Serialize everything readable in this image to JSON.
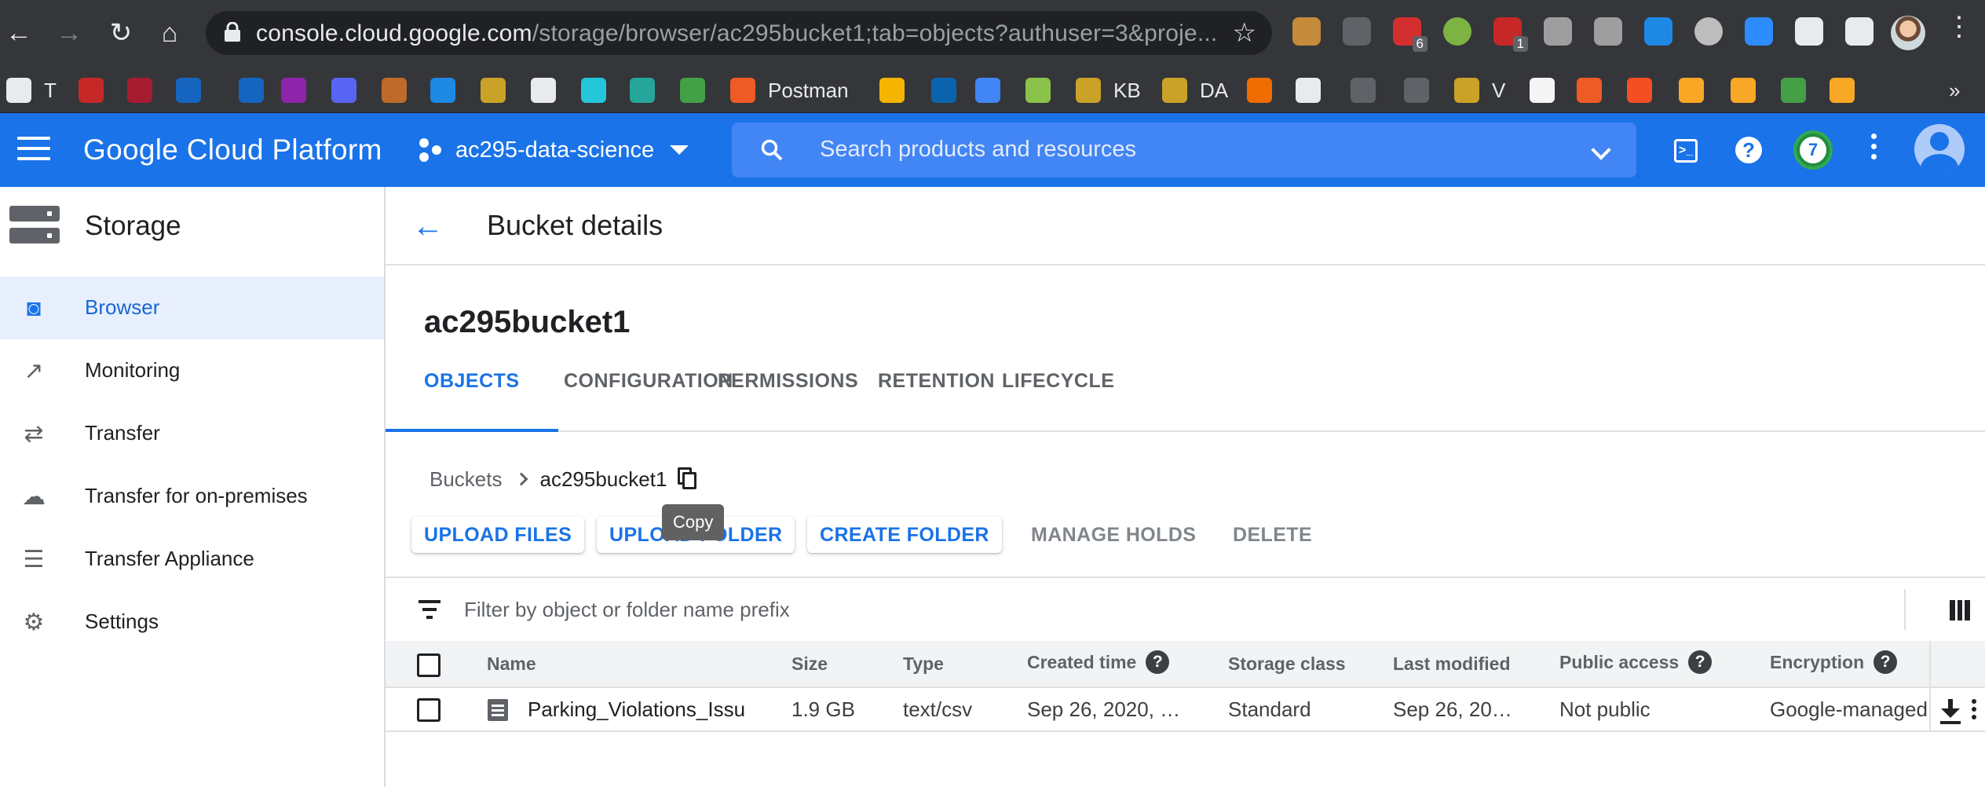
{
  "browser": {
    "url_host": "console.cloud.google.com",
    "url_path": "/storage/browser/ac295bucket1;tab=objects?authuser=3&proje...",
    "extensions": [
      {
        "name": "cookie-extension-icon",
        "color": "#c58a3a"
      },
      {
        "name": "pocket-icon",
        "color": "#5f6368"
      },
      {
        "name": "lastpass-icon",
        "color": "#d32f2f",
        "badge": "6"
      },
      {
        "name": "green-circle-extension-icon",
        "color": "#7cb342"
      },
      {
        "name": "red-hand-extension-icon",
        "color": "#c62828",
        "badge": "1"
      },
      {
        "name": "r-extension-icon",
        "color": "#9e9e9e"
      },
      {
        "name": "copy-extension-icon",
        "color": "#9e9e9e"
      },
      {
        "name": "blue-bolt-extension-icon",
        "color": "#1e88e5"
      },
      {
        "name": "record-extension-icon",
        "color": "#bdbdbd"
      },
      {
        "name": "zoom-icon",
        "color": "#2d8cff"
      },
      {
        "name": "puzzle-extensions-icon",
        "color": "#e8eaed"
      },
      {
        "name": "media-control-icon",
        "color": "#e8eaed"
      }
    ]
  },
  "bookmarks": [
    {
      "name": "globe-bookmark",
      "label": "T",
      "color": "#e8eaed"
    },
    {
      "name": "harvard-shield-bookmark",
      "label": "",
      "color": "#c62828"
    },
    {
      "name": "harvard-crimson-bookmark",
      "label": "",
      "color": "#a51c30"
    },
    {
      "name": "yale-bookmark",
      "label": "",
      "color": "#1565c0"
    },
    {
      "name": "yale-bookmark-2",
      "label": "",
      "color": "#1565c0"
    },
    {
      "name": "purple-heart-bookmark",
      "label": "",
      "color": "#8e24aa"
    },
    {
      "name": "discord-bookmark",
      "label": "",
      "color": "#5865f2"
    },
    {
      "name": "feather-bookmark",
      "label": "",
      "color": "#bf6a2a"
    },
    {
      "name": "blue-x-bookmark",
      "label": "",
      "color": "#1e88e5"
    },
    {
      "name": "paper-plane-bookmark",
      "label": "",
      "color": "#c9a227"
    },
    {
      "name": "github-bookmark",
      "label": "",
      "color": "#e8eaed"
    },
    {
      "name": "teal-circle-bookmark",
      "label": "",
      "color": "#26c6da"
    },
    {
      "name": "eye-bookmark",
      "label": "",
      "color": "#26a69a"
    },
    {
      "name": "chart-bookmark",
      "label": "",
      "color": "#43a047"
    },
    {
      "name": "postman-bookmark",
      "label": "Postman",
      "color": "#ef5b25"
    },
    {
      "name": "j-bookmark",
      "label": "",
      "color": "#f4b400"
    },
    {
      "name": "outlook-bookmark",
      "label": "",
      "color": "#0a64ad"
    },
    {
      "name": "briefcase-bookmark",
      "label": "",
      "color": "#4285f4"
    },
    {
      "name": "ring-bookmark",
      "label": "",
      "color": "#8bc34a"
    },
    {
      "name": "kb-bookmark",
      "label": "KB",
      "color": "#c9a227"
    },
    {
      "name": "da-bookmark",
      "label": "DA",
      "color": "#c9a227"
    },
    {
      "name": "orange-grid-bookmark",
      "label": "",
      "color": "#ef6c00"
    },
    {
      "name": "github-bookmark-2",
      "label": "",
      "color": "#e8eaed"
    },
    {
      "name": "github-bookmark-3",
      "label": "",
      "color": "#5f6368"
    },
    {
      "name": "github-bookmark-4",
      "label": "",
      "color": "#5f6368"
    },
    {
      "name": "v-bookmark",
      "label": "V",
      "color": "#c9a227"
    },
    {
      "name": "af-bookmark",
      "label": "",
      "color": "#f5f5f5"
    },
    {
      "name": "red-clock-bookmark",
      "label": "",
      "color": "#ef5b25"
    },
    {
      "name": "microsoft-bookmark",
      "label": "",
      "color": "#f25022"
    },
    {
      "name": "figure-bookmark",
      "label": "",
      "color": "#f9a825"
    },
    {
      "name": "figure-bookmark-2",
      "label": "",
      "color": "#f9a825"
    },
    {
      "name": "green-ring-bookmark",
      "label": "",
      "color": "#43a047"
    },
    {
      "name": "orange-app-bookmark",
      "label": "",
      "color": "#f9a825"
    }
  ],
  "header": {
    "app_title": "Google Cloud Platform",
    "project_name": "ac295-data-science",
    "search_placeholder": "Search products and resources",
    "notification_count": "7"
  },
  "sidebar": {
    "title": "Storage",
    "items": [
      {
        "label": "Browser",
        "icon": "bucket-icon",
        "active": true
      },
      {
        "label": "Monitoring",
        "icon": "chart-icon",
        "active": false
      },
      {
        "label": "Transfer",
        "icon": "swap-arrows-icon",
        "active": false
      },
      {
        "label": "Transfer for on-premises",
        "icon": "cloud-upload-icon",
        "active": false
      },
      {
        "label": "Transfer Appliance",
        "icon": "list-icon",
        "active": false
      },
      {
        "label": "Settings",
        "icon": "gear-icon",
        "active": false
      }
    ]
  },
  "page": {
    "title": "Bucket details",
    "bucket_name": "ac295bucket1",
    "tabs": [
      {
        "label": "OBJECTS",
        "active": true
      },
      {
        "label": "CONFIGURATION",
        "active": false
      },
      {
        "label": "PERMISSIONS",
        "active": false
      },
      {
        "label": "RETENTION",
        "active": false
      },
      {
        "label": "LIFECYCLE",
        "active": false
      }
    ],
    "breadcrumb": {
      "root": "Buckets",
      "current": "ac295bucket1"
    },
    "tooltip": "Copy",
    "actions": {
      "upload_files": "UPLOAD FILES",
      "upload_folder": "UPLOAD FOLDER",
      "create_folder": "CREATE FOLDER",
      "manage_holds": "MANAGE HOLDS",
      "delete": "DELETE"
    },
    "filter_placeholder": "Filter by object or folder name prefix"
  },
  "table": {
    "columns": {
      "name": "Name",
      "size": "Size",
      "type": "Type",
      "created": "Created time",
      "storage_class": "Storage class",
      "last_modified": "Last modified",
      "public_access": "Public access",
      "encryption": "Encryption"
    },
    "rows": [
      {
        "name": "Parking_Violations_Issu",
        "size": "1.9 GB",
        "type": "text/csv",
        "created": "Sep 26, 2020, …",
        "storage_class": "Standard",
        "last_modified": "Sep 26, 20…",
        "public_access": "Not public",
        "encryption": "Google-managed"
      }
    ]
  }
}
